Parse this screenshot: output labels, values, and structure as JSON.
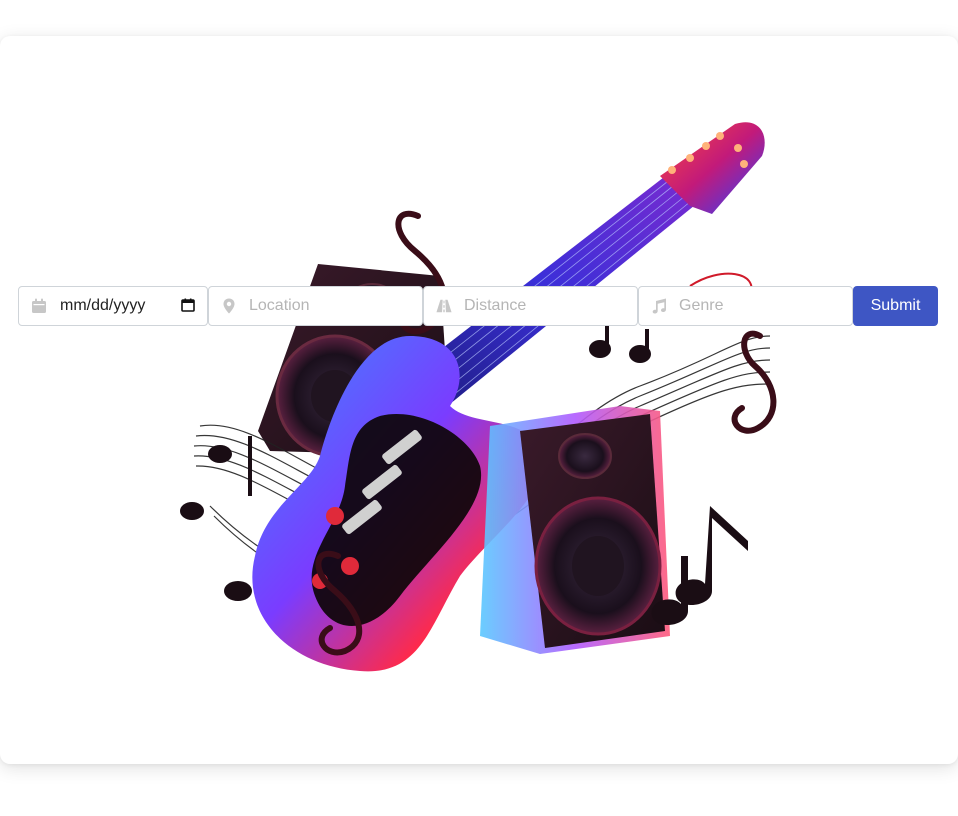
{
  "search": {
    "date_placeholder": "mm/dd/yyyy",
    "location_placeholder": "Location",
    "distance_placeholder": "Distance",
    "genre_placeholder": "Genre",
    "submit_label": "Submit"
  },
  "icons": {
    "date": "calendar-icon",
    "location": "map-marker-icon",
    "distance": "road-icon",
    "genre": "music-note-icon",
    "date_picker": "calendar-picker-icon"
  },
  "hero": {
    "image": "electric-guitar-speakers-music-notes"
  },
  "colors": {
    "accent": "#3e56c4",
    "border": "#cfd4d9",
    "placeholder": "#b5b5b5",
    "icon": "#c7c7c7"
  }
}
